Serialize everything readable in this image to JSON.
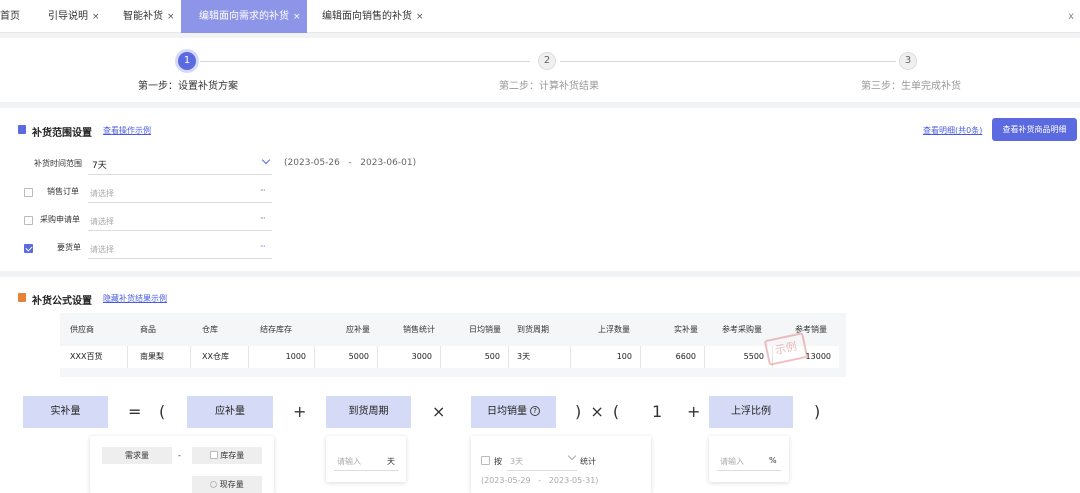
{
  "tabs": [
    {
      "label": "首页",
      "closable": false,
      "active": false
    },
    {
      "label": "引导说明",
      "closable": true,
      "active": false
    },
    {
      "label": "智能补货",
      "closable": true,
      "active": false
    },
    {
      "label": "编辑面向需求的补货",
      "closable": true,
      "active": true
    },
    {
      "label": "编辑面向销售的补货",
      "closable": true,
      "active": false
    }
  ],
  "close_glyph": "×",
  "tabbar_more": "x",
  "steps": [
    {
      "num": "1",
      "label": "第一步：设置补货方案",
      "active": true
    },
    {
      "num": "2",
      "label": "第二步：计算补货结果",
      "active": false
    },
    {
      "num": "3",
      "label": "第三步：生单完成补货",
      "active": false
    }
  ],
  "scope": {
    "title": "补货范围设置",
    "example_link": "查看操作示例",
    "detail_link": "查看明细(共0条)",
    "detail_button": "查看补货商品明细",
    "time_label": "补货时间范围",
    "time_value": "7天",
    "date_start": "(2023-05-26",
    "date_sep": "-",
    "date_end": "2023-06-01)",
    "rows": [
      {
        "label": "销售订单",
        "placeholder": "请选择",
        "checked": false
      },
      {
        "label": "采购申请单",
        "placeholder": "请选择",
        "checked": false
      },
      {
        "label": "要货单",
        "placeholder": "请选择",
        "checked": true
      }
    ],
    "more_glyph": "···"
  },
  "formula_section": {
    "title": "补货公式设置",
    "hide_link": "隐藏补货结果示例",
    "table": {
      "headers": [
        "供应商",
        "商品",
        "仓库",
        "结存库存",
        "应补量",
        "销售统计",
        "日均销量",
        "到货周期",
        "上浮数量",
        "实补量",
        "参考采购量",
        "参考销量"
      ],
      "row": [
        "XXX百货",
        "南果梨",
        "XX仓库",
        "1000",
        "5000",
        "3000",
        "500",
        "3天",
        "100",
        "6600",
        "5500",
        "13000"
      ],
      "stamp": "示例"
    },
    "formula": {
      "result": "实补量",
      "eq": "=",
      "lparen": "(",
      "should": "应补量",
      "plus": "+",
      "cycle": "到货周期",
      "times": "×",
      "daily": "日均销量",
      "q": "?",
      "rparen_times": ") × (",
      "one": "1",
      "plus2": "+",
      "rise": "上浮比例",
      "rparen": ")"
    },
    "pop_should": {
      "demand": "需求量",
      "minus": "-",
      "stock": "库存量",
      "current": "现存量"
    },
    "pop_cycle": {
      "placeholder": "请输入",
      "unit": "天"
    },
    "pop_daily": {
      "by": "按",
      "period": "3天",
      "stat": "统计",
      "start": "(2023-05-29",
      "sep": "-",
      "end": "2023-05-31)"
    },
    "pop_rise": {
      "placeholder": "请输入",
      "unit": "%"
    }
  },
  "colors": {
    "accent": "#5b6ae0",
    "tab_active": "#8c95e8",
    "formula_box": "#d5dbf6"
  }
}
